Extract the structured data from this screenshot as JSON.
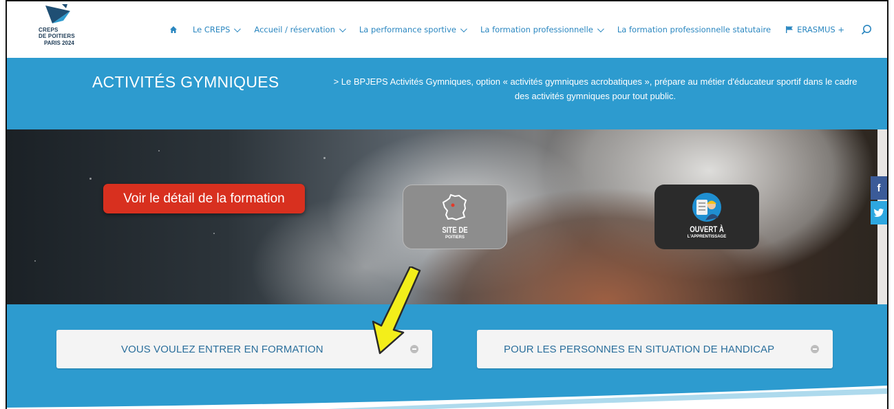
{
  "logo": {
    "line1": "CREPS",
    "line2": "DE POITIERS",
    "line3": "PARIS 2024"
  },
  "nav": {
    "items": [
      {
        "label": "Le CREPS",
        "dropdown": true
      },
      {
        "label": "Accueil / réservation",
        "dropdown": true
      },
      {
        "label": "La performance sportive",
        "dropdown": true
      },
      {
        "label": "La formation professionnelle",
        "dropdown": true
      },
      {
        "label": "La formation professionnelle statutaire",
        "dropdown": false
      },
      {
        "label": "ERASMUS +",
        "dropdown": false
      }
    ]
  },
  "band": {
    "title": "ACTIVITÉS GYMNIQUES",
    "description": "> Le BPJEPS Activités Gymniques, option « activités gymniques acrobatiques », prépare au métier d'éducateur sportif dans le cadre des activités gymniques pour tout public."
  },
  "hero": {
    "cta_label": "Voir le détail de la formation",
    "badge_site": {
      "big": "SITE DE",
      "small": "POITIERS"
    },
    "badge_appr": {
      "big": "OUVERT À",
      "small": "L'APPRENTISSAGE"
    }
  },
  "social": {
    "facebook": "f",
    "twitter": "t"
  },
  "toggles": [
    {
      "label": "VOUS VOULEZ ENTRER EN FORMATION"
    },
    {
      "label": "POUR LES PERSONNES EN SITUATION DE HANDICAP"
    }
  ],
  "colors": {
    "accent_blue": "#2d9bcf",
    "nav_link": "#2b87c0",
    "cta_red": "#d8301f",
    "annotation_arrow": "#f3ee1a"
  }
}
